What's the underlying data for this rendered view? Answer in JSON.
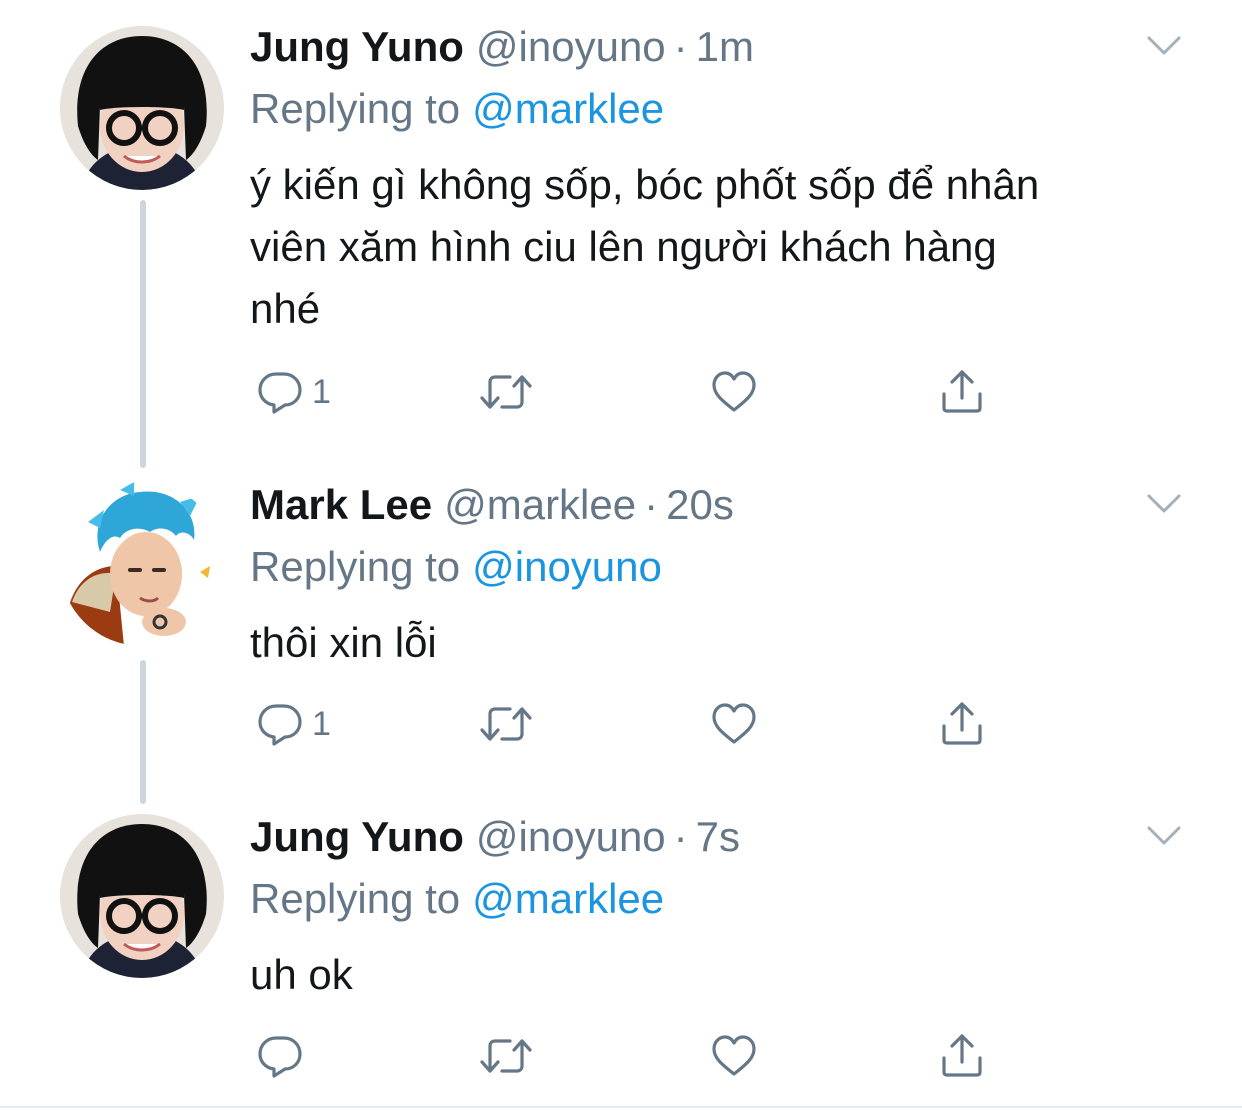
{
  "colors": {
    "text": "#14171a",
    "secondary": "#657786",
    "link": "#1b95e0",
    "thread_line": "#ccd6dd"
  },
  "tweets": [
    {
      "name": "Jung Yuno",
      "handle": "@inoyuno",
      "dot": "·",
      "time": "1m",
      "replying_label": "Replying to",
      "replying_to": "@marklee",
      "text_lines": [
        "ý kiến gì không sốp, bóc phốt sốp để nhân",
        "viên xăm hình ciu lên người khách hàng",
        "nhé"
      ],
      "reply_count": "1",
      "icons": [
        "reply-icon",
        "retweet-icon",
        "like-icon",
        "share-icon",
        "chevron-down-icon"
      ]
    },
    {
      "name": "Mark Lee",
      "handle": "@marklee",
      "dot": "·",
      "time": "20s",
      "replying_label": "Replying to",
      "replying_to": "@inoyuno",
      "text_lines": [
        "thôi xin lỗi"
      ],
      "reply_count": "1",
      "icons": [
        "reply-icon",
        "retweet-icon",
        "like-icon",
        "share-icon",
        "chevron-down-icon"
      ]
    },
    {
      "name": "Jung Yuno",
      "handle": "@inoyuno",
      "dot": "·",
      "time": "7s",
      "replying_label": "Replying to",
      "replying_to": "@marklee",
      "text_lines": [
        "uh ok"
      ],
      "reply_count": "",
      "icons": [
        "reply-icon",
        "retweet-icon",
        "like-icon",
        "share-icon",
        "chevron-down-icon"
      ]
    }
  ]
}
